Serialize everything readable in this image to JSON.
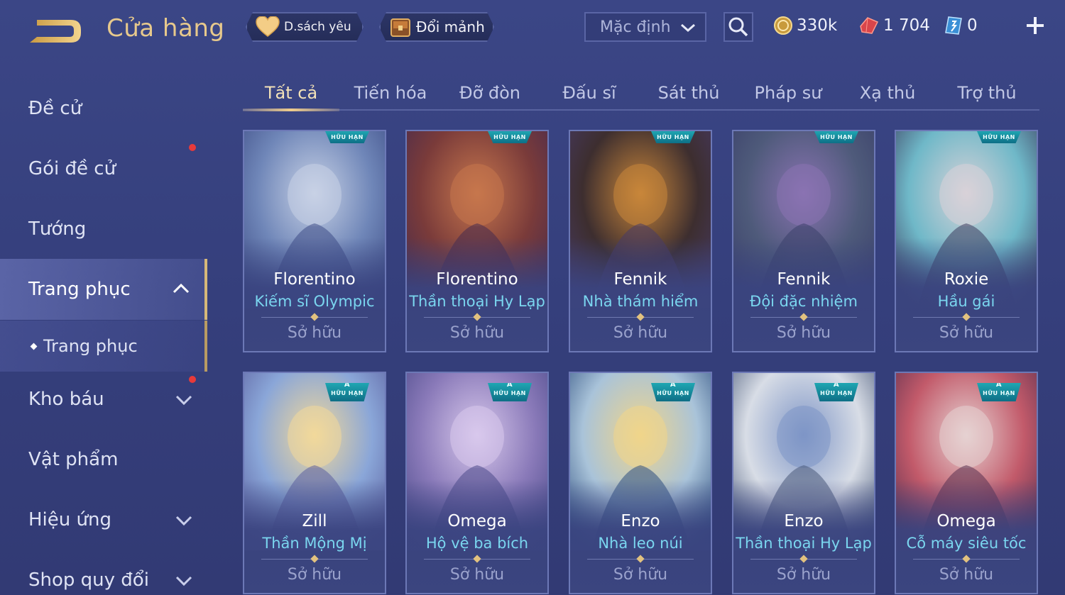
{
  "header": {
    "title": "Cửa hàng",
    "wishlist_label": "D.sách yêu",
    "exchange_label": "Đổi mảnh",
    "sort_value": "Mặc định"
  },
  "currencies": {
    "gold": "330k",
    "ruby": "1 704",
    "voucher": "0"
  },
  "sidebar": {
    "items": [
      {
        "label": "Đề cử",
        "dot": false
      },
      {
        "label": "Gói đề cử",
        "dot": true
      },
      {
        "label": "Tướng",
        "dot": false
      },
      {
        "label": "Trang phục",
        "dot": false
      },
      {
        "label": "Trang phục",
        "dot": false
      },
      {
        "label": "Kho báu",
        "dot": true
      },
      {
        "label": "Vật phẩm",
        "dot": false
      },
      {
        "label": "Hiệu ứng",
        "dot": false
      },
      {
        "label": "Shop quy đổi",
        "dot": false
      }
    ]
  },
  "tabs": [
    "Tất cả",
    "Tiến hóa",
    "Đỡ đòn",
    "Đấu sĩ",
    "Sát thủ",
    "Pháp sư",
    "Xạ thủ",
    "Trợ thủ"
  ],
  "badge_label": "HỮU HẠN",
  "badge_grade": "A",
  "cards": [
    {
      "hero": "Florentino",
      "skin": "Kiếm sĩ Olympic",
      "status": "Sở hữu",
      "grade": false,
      "colors": [
        "#6f86b8",
        "#c8d2e6",
        "#3e4d86"
      ]
    },
    {
      "hero": "Florentino",
      "skin": "Thần thoại Hy Lạp",
      "status": "Sở hữu",
      "grade": false,
      "colors": [
        "#7a3b3a",
        "#c7774d",
        "#452a4e"
      ]
    },
    {
      "hero": "Fennik",
      "skin": "Nhà thám hiểm",
      "status": "Sở hữu",
      "grade": false,
      "colors": [
        "#3d2e2f",
        "#c9863a",
        "#473a66"
      ]
    },
    {
      "hero": "Fennik",
      "skin": "Đội đặc nhiệm",
      "status": "Sở hữu",
      "grade": false,
      "colors": [
        "#4e5a7a",
        "#8a73b2",
        "#3a3f6a"
      ]
    },
    {
      "hero": "Roxie",
      "skin": "Hầu gái",
      "status": "Sở hữu",
      "grade": false,
      "colors": [
        "#6fb8c8",
        "#d9d2d8",
        "#3c3d5e"
      ]
    },
    {
      "hero": "Zill",
      "skin": "Thần Mộng Mị",
      "status": "Sở hữu",
      "grade": true,
      "colors": [
        "#8aa6d8",
        "#f2d99a",
        "#5b5f9e"
      ]
    },
    {
      "hero": "Omega",
      "skin": "Hộ vệ ba bích",
      "status": "Sở hữu",
      "grade": true,
      "colors": [
        "#8a7ab9",
        "#d8c8ec",
        "#4c4a8a"
      ]
    },
    {
      "hero": "Enzo",
      "skin": "Nhà leo núi",
      "status": "Sở hữu",
      "grade": true,
      "colors": [
        "#a9c3d9",
        "#f0d58a",
        "#2e4f80"
      ]
    },
    {
      "hero": "Enzo",
      "skin": "Thần thoại Hy Lạp",
      "status": "Sở hữu",
      "grade": true,
      "colors": [
        "#d8dde6",
        "#7e95c6",
        "#4a5a7a"
      ]
    },
    {
      "hero": "Omega",
      "skin": "Cỗ máy siêu tốc",
      "status": "Sở hữu",
      "grade": true,
      "colors": [
        "#c25a6a",
        "#e6d2d2",
        "#5a2f4e"
      ]
    }
  ]
}
